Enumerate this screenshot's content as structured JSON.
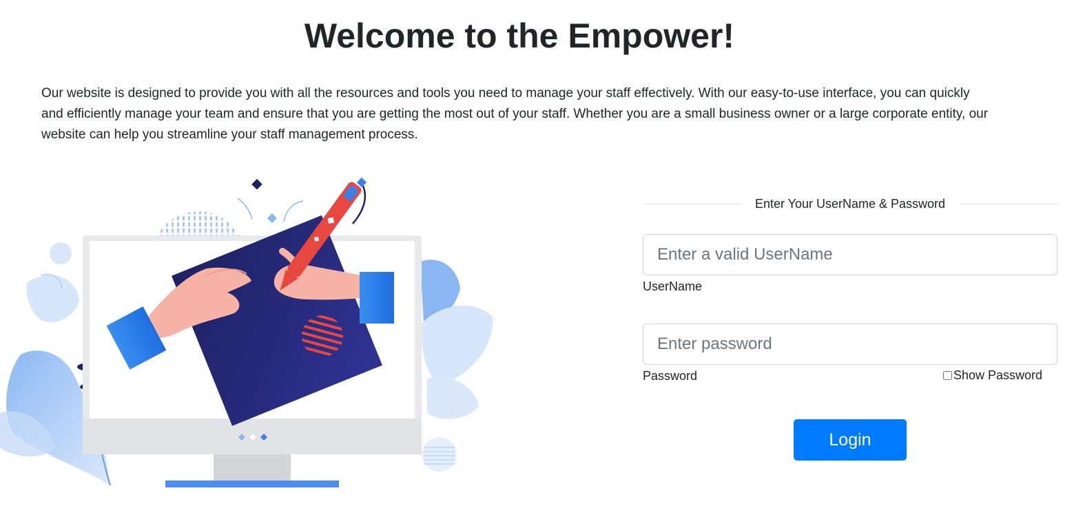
{
  "header": {
    "title": "Welcome to the Empower!",
    "intro": "Our website is designed to provide you with all the resources and tools you need to manage your staff effectively. With our easy-to-use interface, you can quickly and efficiently manage your team and ensure that you are getting the most out of your staff. Whether you are a small business owner or a large corporate entity, our website can help you streamline your staff management process."
  },
  "login": {
    "heading": "Enter Your UserName & Password",
    "username": {
      "placeholder": "Enter a valid UserName",
      "value": "",
      "label": "UserName"
    },
    "password": {
      "placeholder": "Enter password",
      "value": "",
      "label": "Password"
    },
    "show_password_label": "Show Password",
    "show_password_checked": false,
    "submit_label": "Login"
  },
  "colors": {
    "primary": "#007bff",
    "navy": "#1e2161",
    "accent_red": "#e8473f",
    "light_blue": "#9ec2f5"
  }
}
